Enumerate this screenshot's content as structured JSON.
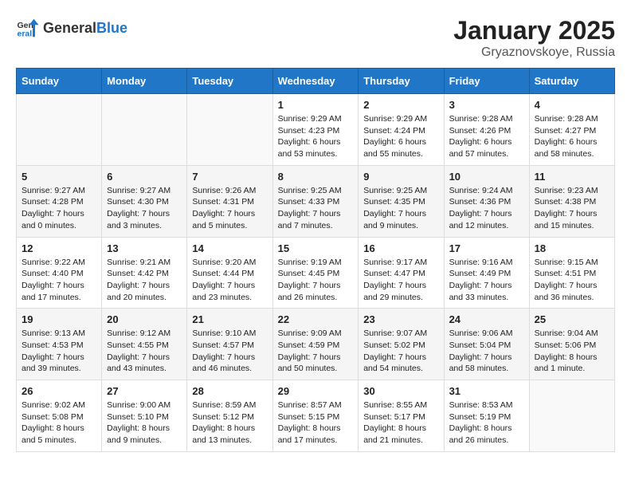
{
  "header": {
    "logo_general": "General",
    "logo_blue": "Blue",
    "title": "January 2025",
    "subtitle": "Gryaznovskoye, Russia"
  },
  "weekdays": [
    "Sunday",
    "Monday",
    "Tuesday",
    "Wednesday",
    "Thursday",
    "Friday",
    "Saturday"
  ],
  "weeks": [
    [
      {
        "day": "",
        "sunrise": "",
        "sunset": "",
        "daylight": ""
      },
      {
        "day": "",
        "sunrise": "",
        "sunset": "",
        "daylight": ""
      },
      {
        "day": "",
        "sunrise": "",
        "sunset": "",
        "daylight": ""
      },
      {
        "day": "1",
        "sunrise": "Sunrise: 9:29 AM",
        "sunset": "Sunset: 4:23 PM",
        "daylight": "Daylight: 6 hours and 53 minutes."
      },
      {
        "day": "2",
        "sunrise": "Sunrise: 9:29 AM",
        "sunset": "Sunset: 4:24 PM",
        "daylight": "Daylight: 6 hours and 55 minutes."
      },
      {
        "day": "3",
        "sunrise": "Sunrise: 9:28 AM",
        "sunset": "Sunset: 4:26 PM",
        "daylight": "Daylight: 6 hours and 57 minutes."
      },
      {
        "day": "4",
        "sunrise": "Sunrise: 9:28 AM",
        "sunset": "Sunset: 4:27 PM",
        "daylight": "Daylight: 6 hours and 58 minutes."
      }
    ],
    [
      {
        "day": "5",
        "sunrise": "Sunrise: 9:27 AM",
        "sunset": "Sunset: 4:28 PM",
        "daylight": "Daylight: 7 hours and 0 minutes."
      },
      {
        "day": "6",
        "sunrise": "Sunrise: 9:27 AM",
        "sunset": "Sunset: 4:30 PM",
        "daylight": "Daylight: 7 hours and 3 minutes."
      },
      {
        "day": "7",
        "sunrise": "Sunrise: 9:26 AM",
        "sunset": "Sunset: 4:31 PM",
        "daylight": "Daylight: 7 hours and 5 minutes."
      },
      {
        "day": "8",
        "sunrise": "Sunrise: 9:25 AM",
        "sunset": "Sunset: 4:33 PM",
        "daylight": "Daylight: 7 hours and 7 minutes."
      },
      {
        "day": "9",
        "sunrise": "Sunrise: 9:25 AM",
        "sunset": "Sunset: 4:35 PM",
        "daylight": "Daylight: 7 hours and 9 minutes."
      },
      {
        "day": "10",
        "sunrise": "Sunrise: 9:24 AM",
        "sunset": "Sunset: 4:36 PM",
        "daylight": "Daylight: 7 hours and 12 minutes."
      },
      {
        "day": "11",
        "sunrise": "Sunrise: 9:23 AM",
        "sunset": "Sunset: 4:38 PM",
        "daylight": "Daylight: 7 hours and 15 minutes."
      }
    ],
    [
      {
        "day": "12",
        "sunrise": "Sunrise: 9:22 AM",
        "sunset": "Sunset: 4:40 PM",
        "daylight": "Daylight: 7 hours and 17 minutes."
      },
      {
        "day": "13",
        "sunrise": "Sunrise: 9:21 AM",
        "sunset": "Sunset: 4:42 PM",
        "daylight": "Daylight: 7 hours and 20 minutes."
      },
      {
        "day": "14",
        "sunrise": "Sunrise: 9:20 AM",
        "sunset": "Sunset: 4:44 PM",
        "daylight": "Daylight: 7 hours and 23 minutes."
      },
      {
        "day": "15",
        "sunrise": "Sunrise: 9:19 AM",
        "sunset": "Sunset: 4:45 PM",
        "daylight": "Daylight: 7 hours and 26 minutes."
      },
      {
        "day": "16",
        "sunrise": "Sunrise: 9:17 AM",
        "sunset": "Sunset: 4:47 PM",
        "daylight": "Daylight: 7 hours and 29 minutes."
      },
      {
        "day": "17",
        "sunrise": "Sunrise: 9:16 AM",
        "sunset": "Sunset: 4:49 PM",
        "daylight": "Daylight: 7 hours and 33 minutes."
      },
      {
        "day": "18",
        "sunrise": "Sunrise: 9:15 AM",
        "sunset": "Sunset: 4:51 PM",
        "daylight": "Daylight: 7 hours and 36 minutes."
      }
    ],
    [
      {
        "day": "19",
        "sunrise": "Sunrise: 9:13 AM",
        "sunset": "Sunset: 4:53 PM",
        "daylight": "Daylight: 7 hours and 39 minutes."
      },
      {
        "day": "20",
        "sunrise": "Sunrise: 9:12 AM",
        "sunset": "Sunset: 4:55 PM",
        "daylight": "Daylight: 7 hours and 43 minutes."
      },
      {
        "day": "21",
        "sunrise": "Sunrise: 9:10 AM",
        "sunset": "Sunset: 4:57 PM",
        "daylight": "Daylight: 7 hours and 46 minutes."
      },
      {
        "day": "22",
        "sunrise": "Sunrise: 9:09 AM",
        "sunset": "Sunset: 4:59 PM",
        "daylight": "Daylight: 7 hours and 50 minutes."
      },
      {
        "day": "23",
        "sunrise": "Sunrise: 9:07 AM",
        "sunset": "Sunset: 5:02 PM",
        "daylight": "Daylight: 7 hours and 54 minutes."
      },
      {
        "day": "24",
        "sunrise": "Sunrise: 9:06 AM",
        "sunset": "Sunset: 5:04 PM",
        "daylight": "Daylight: 7 hours and 58 minutes."
      },
      {
        "day": "25",
        "sunrise": "Sunrise: 9:04 AM",
        "sunset": "Sunset: 5:06 PM",
        "daylight": "Daylight: 8 hours and 1 minute."
      }
    ],
    [
      {
        "day": "26",
        "sunrise": "Sunrise: 9:02 AM",
        "sunset": "Sunset: 5:08 PM",
        "daylight": "Daylight: 8 hours and 5 minutes."
      },
      {
        "day": "27",
        "sunrise": "Sunrise: 9:00 AM",
        "sunset": "Sunset: 5:10 PM",
        "daylight": "Daylight: 8 hours and 9 minutes."
      },
      {
        "day": "28",
        "sunrise": "Sunrise: 8:59 AM",
        "sunset": "Sunset: 5:12 PM",
        "daylight": "Daylight: 8 hours and 13 minutes."
      },
      {
        "day": "29",
        "sunrise": "Sunrise: 8:57 AM",
        "sunset": "Sunset: 5:15 PM",
        "daylight": "Daylight: 8 hours and 17 minutes."
      },
      {
        "day": "30",
        "sunrise": "Sunrise: 8:55 AM",
        "sunset": "Sunset: 5:17 PM",
        "daylight": "Daylight: 8 hours and 21 minutes."
      },
      {
        "day": "31",
        "sunrise": "Sunrise: 8:53 AM",
        "sunset": "Sunset: 5:19 PM",
        "daylight": "Daylight: 8 hours and 26 minutes."
      },
      {
        "day": "",
        "sunrise": "",
        "sunset": "",
        "daylight": ""
      }
    ]
  ]
}
